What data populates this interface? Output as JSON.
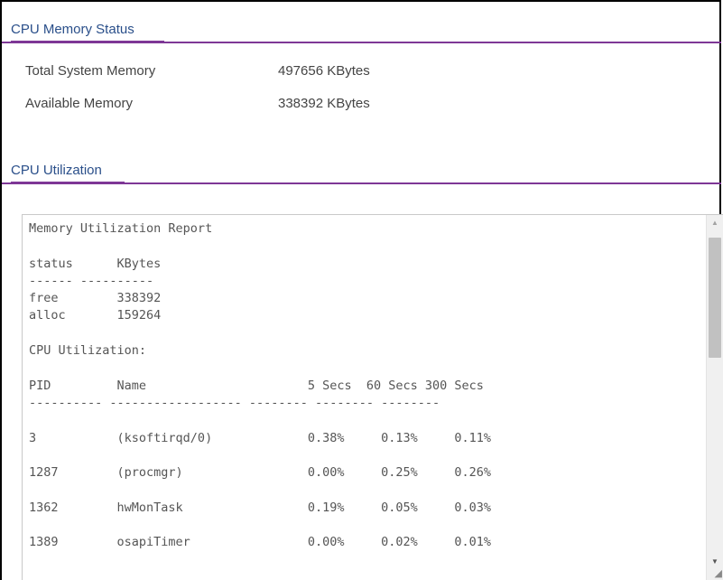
{
  "memory_status": {
    "title": "CPU Memory Status",
    "total_label": "Total System Memory",
    "total_value": "497656 KBytes",
    "available_label": "Available Memory",
    "available_value": "338392 KBytes"
  },
  "cpu_utilization": {
    "title": "CPU Utilization",
    "report": "Memory Utilization Report\n\nstatus      KBytes\n------ ----------\nfree        338392\nalloc       159264\n\nCPU Utilization:\n\nPID         Name                      5 Secs  60 Secs 300 Secs\n---------- ------------------ -------- -------- --------\n\n3           (ksoftirqd/0)             0.38%     0.13%     0.11%\n\n1287        (procmgr)                 0.00%     0.25%     0.26%\n\n1362        hwMonTask                 0.19%     0.05%     0.03%\n\n1389        osapiTimer                0.00%     0.02%     0.01%",
    "scroll_up_icon": "arrow-up",
    "scroll_down_icon": "arrow-down",
    "resize_icon": "resize-grip"
  },
  "colors": {
    "accent": "#7e3796",
    "title_text": "#2a4f8a"
  }
}
